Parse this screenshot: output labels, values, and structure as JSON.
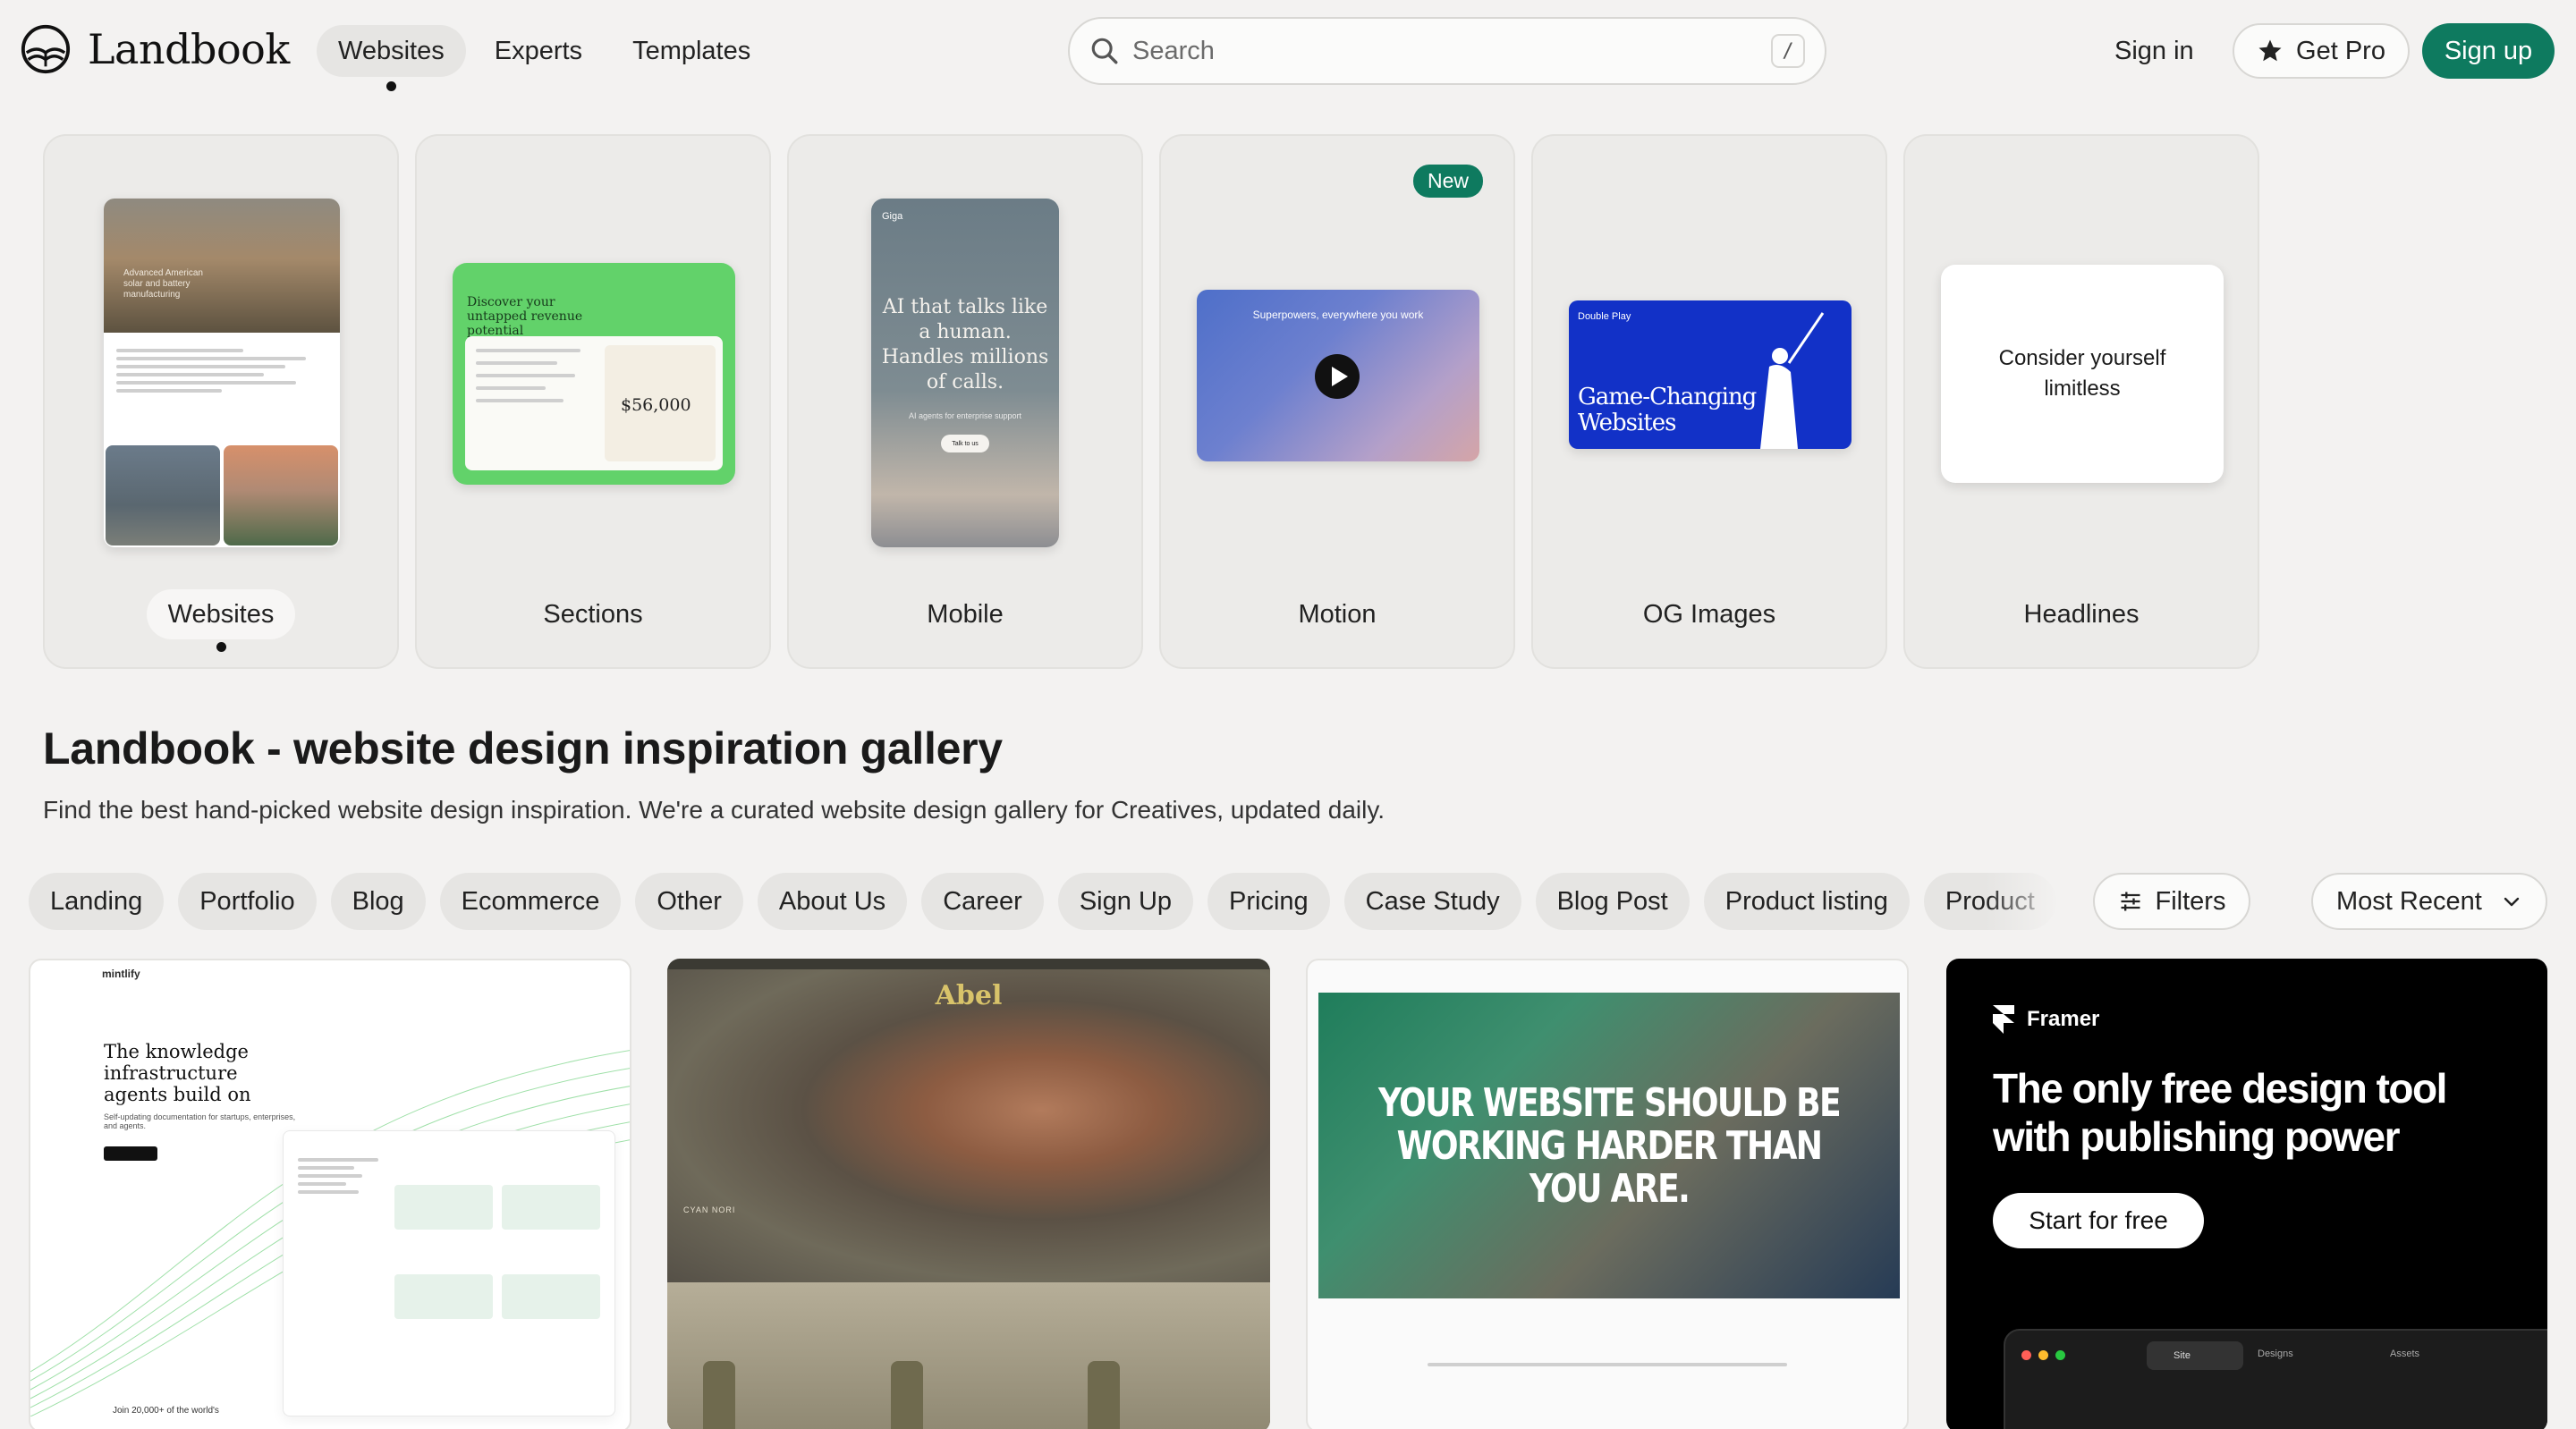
{
  "header": {
    "logo_text": "Landbook",
    "nav": [
      {
        "label": "Websites",
        "active": true
      },
      {
        "label": "Experts",
        "active": false
      },
      {
        "label": "Templates",
        "active": false
      }
    ],
    "search": {
      "placeholder": "Search",
      "shortcut": "/"
    },
    "sign_in": "Sign in",
    "get_pro": "Get Pro",
    "sign_up": "Sign up"
  },
  "categories": [
    {
      "label": "Websites",
      "active": true
    },
    {
      "label": "Sections"
    },
    {
      "label": "Mobile"
    },
    {
      "label": "Motion",
      "badge": "New"
    },
    {
      "label": "OG Images"
    },
    {
      "label": "Headlines"
    }
  ],
  "previews": {
    "websites_hero": "Advanced American solar and battery manufacturing",
    "sections_title": "Discover your untapped revenue potential",
    "sections_price": "$56,000",
    "mobile_brand": "Giga",
    "mobile_headline": "AI that talks like a human. Handles millions of calls.",
    "mobile_sub": "AI agents for enterprise support",
    "mobile_button": "Talk to us",
    "motion_caption": "Superpowers, everywhere you work",
    "og_brand": "Double Play",
    "og_text": "Game-Changing Websites",
    "headlines_text": "Consider yourself limitless"
  },
  "page": {
    "title": "Landbook - website design inspiration gallery",
    "subtitle": "Find the best hand-picked website design inspiration. We're a curated website design gallery for Creatives, updated daily."
  },
  "filters": {
    "chips": [
      "Landing",
      "Portfolio",
      "Blog",
      "Ecommerce",
      "Other",
      "About Us",
      "Career",
      "Sign Up",
      "Pricing",
      "Case Study",
      "Blog Post",
      "Product listing",
      "Product"
    ],
    "filters_label": "Filters",
    "sort_label": "Most Recent"
  },
  "gallery": {
    "mintlify": {
      "brand": "mintlify",
      "headline": "The knowledge infrastructure agents build on",
      "small": "Self-updating documentation for startups, enterprises, and agents.",
      "join": "Join 20,000+ of the world's"
    },
    "abel": {
      "brand": "Abel",
      "caption": "CYAN NORI"
    },
    "pelay": {
      "headline": "YOUR WEBSITE SHOULD BE WORKING HARDER THAN YOU ARE."
    },
    "framer": {
      "brand": "Framer",
      "headline": "The only free design tool with publishing power",
      "cta": "Start for free",
      "tab1": "Site",
      "tab2": "Designs",
      "tab3": "Assets"
    }
  },
  "colors": {
    "brand_green": "#0e7a5f",
    "background": "#f3f2f1",
    "og_blue": "#1231c7"
  }
}
